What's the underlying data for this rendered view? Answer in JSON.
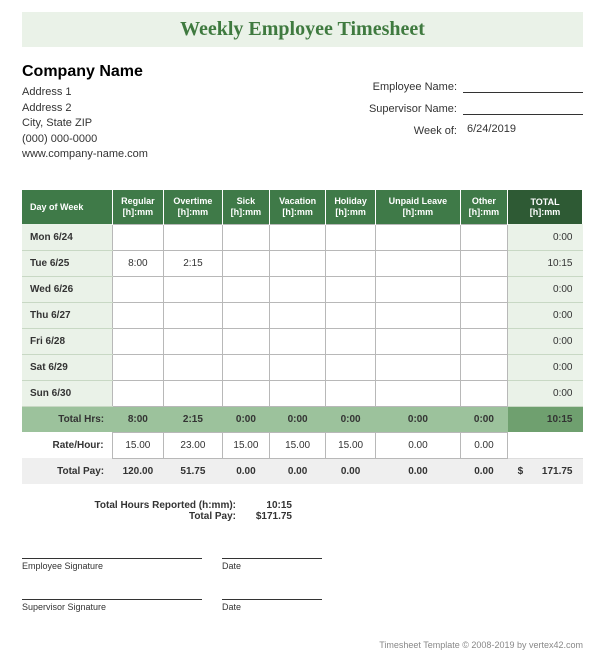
{
  "title": "Weekly Employee Timesheet",
  "company": {
    "name": "Company Name",
    "address1": "Address 1",
    "address2": "Address 2",
    "cityStateZip": "City, State  ZIP",
    "phone": "(000) 000-0000",
    "website": "www.company-name.com"
  },
  "meta": {
    "employeeLabel": "Employee Name:",
    "employeeValue": "",
    "supervisorLabel": "Supervisor Name:",
    "supervisorValue": "",
    "weekOfLabel": "Week of:",
    "weekOfValue": "6/24/2019"
  },
  "columns": {
    "day": "Day of Week",
    "regular": "Regular",
    "overtime": "Overtime",
    "sick": "Sick",
    "vacation": "Vacation",
    "holiday": "Holiday",
    "unpaid": "Unpaid Leave",
    "other": "Other",
    "total": "TOTAL",
    "unit": "[h]:mm"
  },
  "rows": [
    {
      "day": "Mon 6/24",
      "regular": "",
      "overtime": "",
      "sick": "",
      "vacation": "",
      "holiday": "",
      "unpaid": "",
      "other": "",
      "total": "0:00"
    },
    {
      "day": "Tue 6/25",
      "regular": "8:00",
      "overtime": "2:15",
      "sick": "",
      "vacation": "",
      "holiday": "",
      "unpaid": "",
      "other": "",
      "total": "10:15"
    },
    {
      "day": "Wed 6/26",
      "regular": "",
      "overtime": "",
      "sick": "",
      "vacation": "",
      "holiday": "",
      "unpaid": "",
      "other": "",
      "total": "0:00"
    },
    {
      "day": "Thu 6/27",
      "regular": "",
      "overtime": "",
      "sick": "",
      "vacation": "",
      "holiday": "",
      "unpaid": "",
      "other": "",
      "total": "0:00"
    },
    {
      "day": "Fri 6/28",
      "regular": "",
      "overtime": "",
      "sick": "",
      "vacation": "",
      "holiday": "",
      "unpaid": "",
      "other": "",
      "total": "0:00"
    },
    {
      "day": "Sat 6/29",
      "regular": "",
      "overtime": "",
      "sick": "",
      "vacation": "",
      "holiday": "",
      "unpaid": "",
      "other": "",
      "total": "0:00"
    },
    {
      "day": "Sun 6/30",
      "regular": "",
      "overtime": "",
      "sick": "",
      "vacation": "",
      "holiday": "",
      "unpaid": "",
      "other": "",
      "total": "0:00"
    }
  ],
  "totals": {
    "label": "Total Hrs:",
    "regular": "8:00",
    "overtime": "2:15",
    "sick": "0:00",
    "vacation": "0:00",
    "holiday": "0:00",
    "unpaid": "0:00",
    "other": "0:00",
    "grand": "10:15"
  },
  "rate": {
    "label": "Rate/Hour:",
    "regular": "15.00",
    "overtime": "23.00",
    "sick": "15.00",
    "vacation": "15.00",
    "holiday": "15.00",
    "unpaid": "0.00",
    "other": "0.00"
  },
  "pay": {
    "label": "Total Pay:",
    "regular": "120.00",
    "overtime": "51.75",
    "sick": "0.00",
    "vacation": "0.00",
    "holiday": "0.00",
    "unpaid": "0.00",
    "other": "0.00",
    "currency": "$",
    "grand": "171.75"
  },
  "summary": {
    "hoursLabel": "Total Hours Reported (h:mm):",
    "hoursValue": "10:15",
    "payLabel": "Total Pay:",
    "payValue": "$171.75"
  },
  "signatures": {
    "employee": "Employee Signature",
    "supervisor": "Supervisor Signature",
    "date": "Date"
  },
  "footer": "Timesheet Template © 2008-2019 by vertex42.com"
}
